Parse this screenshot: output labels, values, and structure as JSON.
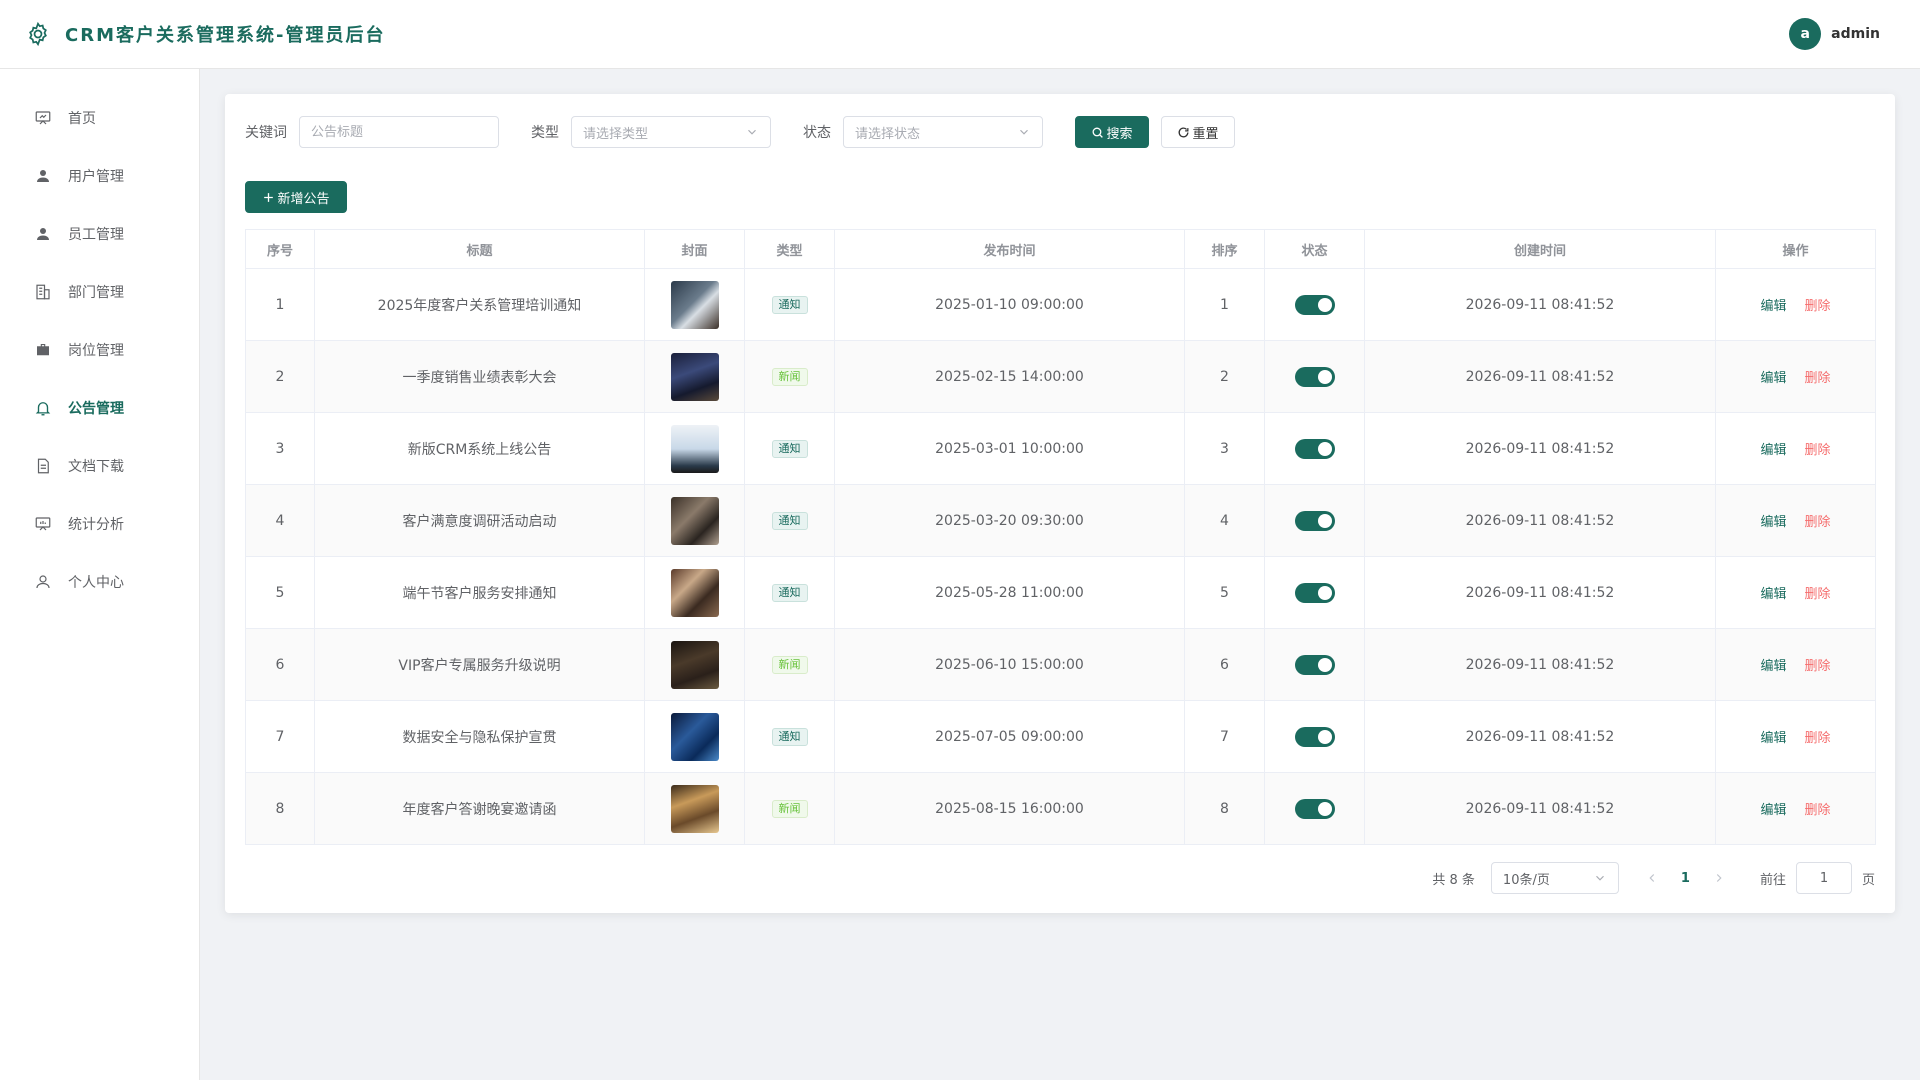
{
  "header": {
    "title": "CRM客户关系管理系统-管理员后台",
    "avatar_letter": "a",
    "username": "admin"
  },
  "sidebar": {
    "items": [
      {
        "label": "首页",
        "icon": "dashboard-icon"
      },
      {
        "label": "用户管理",
        "icon": "user-icon"
      },
      {
        "label": "员工管理",
        "icon": "user-icon"
      },
      {
        "label": "部门管理",
        "icon": "building-icon"
      },
      {
        "label": "岗位管理",
        "icon": "briefcase-icon"
      },
      {
        "label": "公告管理",
        "icon": "bell-icon",
        "active": true
      },
      {
        "label": "文档下载",
        "icon": "document-icon"
      },
      {
        "label": "统计分析",
        "icon": "chart-icon"
      },
      {
        "label": "个人中心",
        "icon": "user-outline-icon"
      }
    ]
  },
  "search": {
    "keyword_label": "关键词",
    "keyword_placeholder": "公告标题",
    "type_label": "类型",
    "type_placeholder": "请选择类型",
    "status_label": "状态",
    "status_placeholder": "请选择状态",
    "search_button": "搜索",
    "reset_button": "重置"
  },
  "toolbar": {
    "add_button": "新增公告"
  },
  "table": {
    "columns": [
      "序号",
      "标题",
      "封面",
      "类型",
      "发布时间",
      "排序",
      "状态",
      "创建时间",
      "操作"
    ],
    "edit_label": "编辑",
    "delete_label": "删除",
    "rows": [
      {
        "no": "1",
        "title": "2025年度客户关系管理培训通知",
        "type": "通知",
        "publish": "2025-01-10 09:00:00",
        "sort": "1",
        "enabled": true,
        "created": "2026-09-11 08:41:52"
      },
      {
        "no": "2",
        "title": "一季度销售业绩表彰大会",
        "type": "新闻",
        "publish": "2025-02-15 14:00:00",
        "sort": "2",
        "enabled": true,
        "created": "2026-09-11 08:41:52"
      },
      {
        "no": "3",
        "title": "新版CRM系统上线公告",
        "type": "通知",
        "publish": "2025-03-01 10:00:00",
        "sort": "3",
        "enabled": true,
        "created": "2026-09-11 08:41:52"
      },
      {
        "no": "4",
        "title": "客户满意度调研活动启动",
        "type": "通知",
        "publish": "2025-03-20 09:30:00",
        "sort": "4",
        "enabled": true,
        "created": "2026-09-11 08:41:52"
      },
      {
        "no": "5",
        "title": "端午节客户服务安排通知",
        "type": "通知",
        "publish": "2025-05-28 11:00:00",
        "sort": "5",
        "enabled": true,
        "created": "2026-09-11 08:41:52"
      },
      {
        "no": "6",
        "title": "VIP客户专属服务升级说明",
        "type": "新闻",
        "publish": "2025-06-10 15:00:00",
        "sort": "6",
        "enabled": true,
        "created": "2026-09-11 08:41:52"
      },
      {
        "no": "7",
        "title": "数据安全与隐私保护宣贯",
        "type": "通知",
        "publish": "2025-07-05 09:00:00",
        "sort": "7",
        "enabled": true,
        "created": "2026-09-11 08:41:52"
      },
      {
        "no": "8",
        "title": "年度客户答谢晚宴邀请函",
        "type": "新闻",
        "publish": "2025-08-15 16:00:00",
        "sort": "8",
        "enabled": true,
        "created": "2026-09-11 08:41:52"
      }
    ]
  },
  "pagination": {
    "total_text": "共 8 条",
    "page_size": "10条/页",
    "current_page": "1",
    "goto_label": "前往",
    "goto_value": "1",
    "page_suffix": "页"
  },
  "colors": {
    "primary": "#1a6b5e",
    "danger": "#f56c6c",
    "news_tag": "#67c23a"
  }
}
